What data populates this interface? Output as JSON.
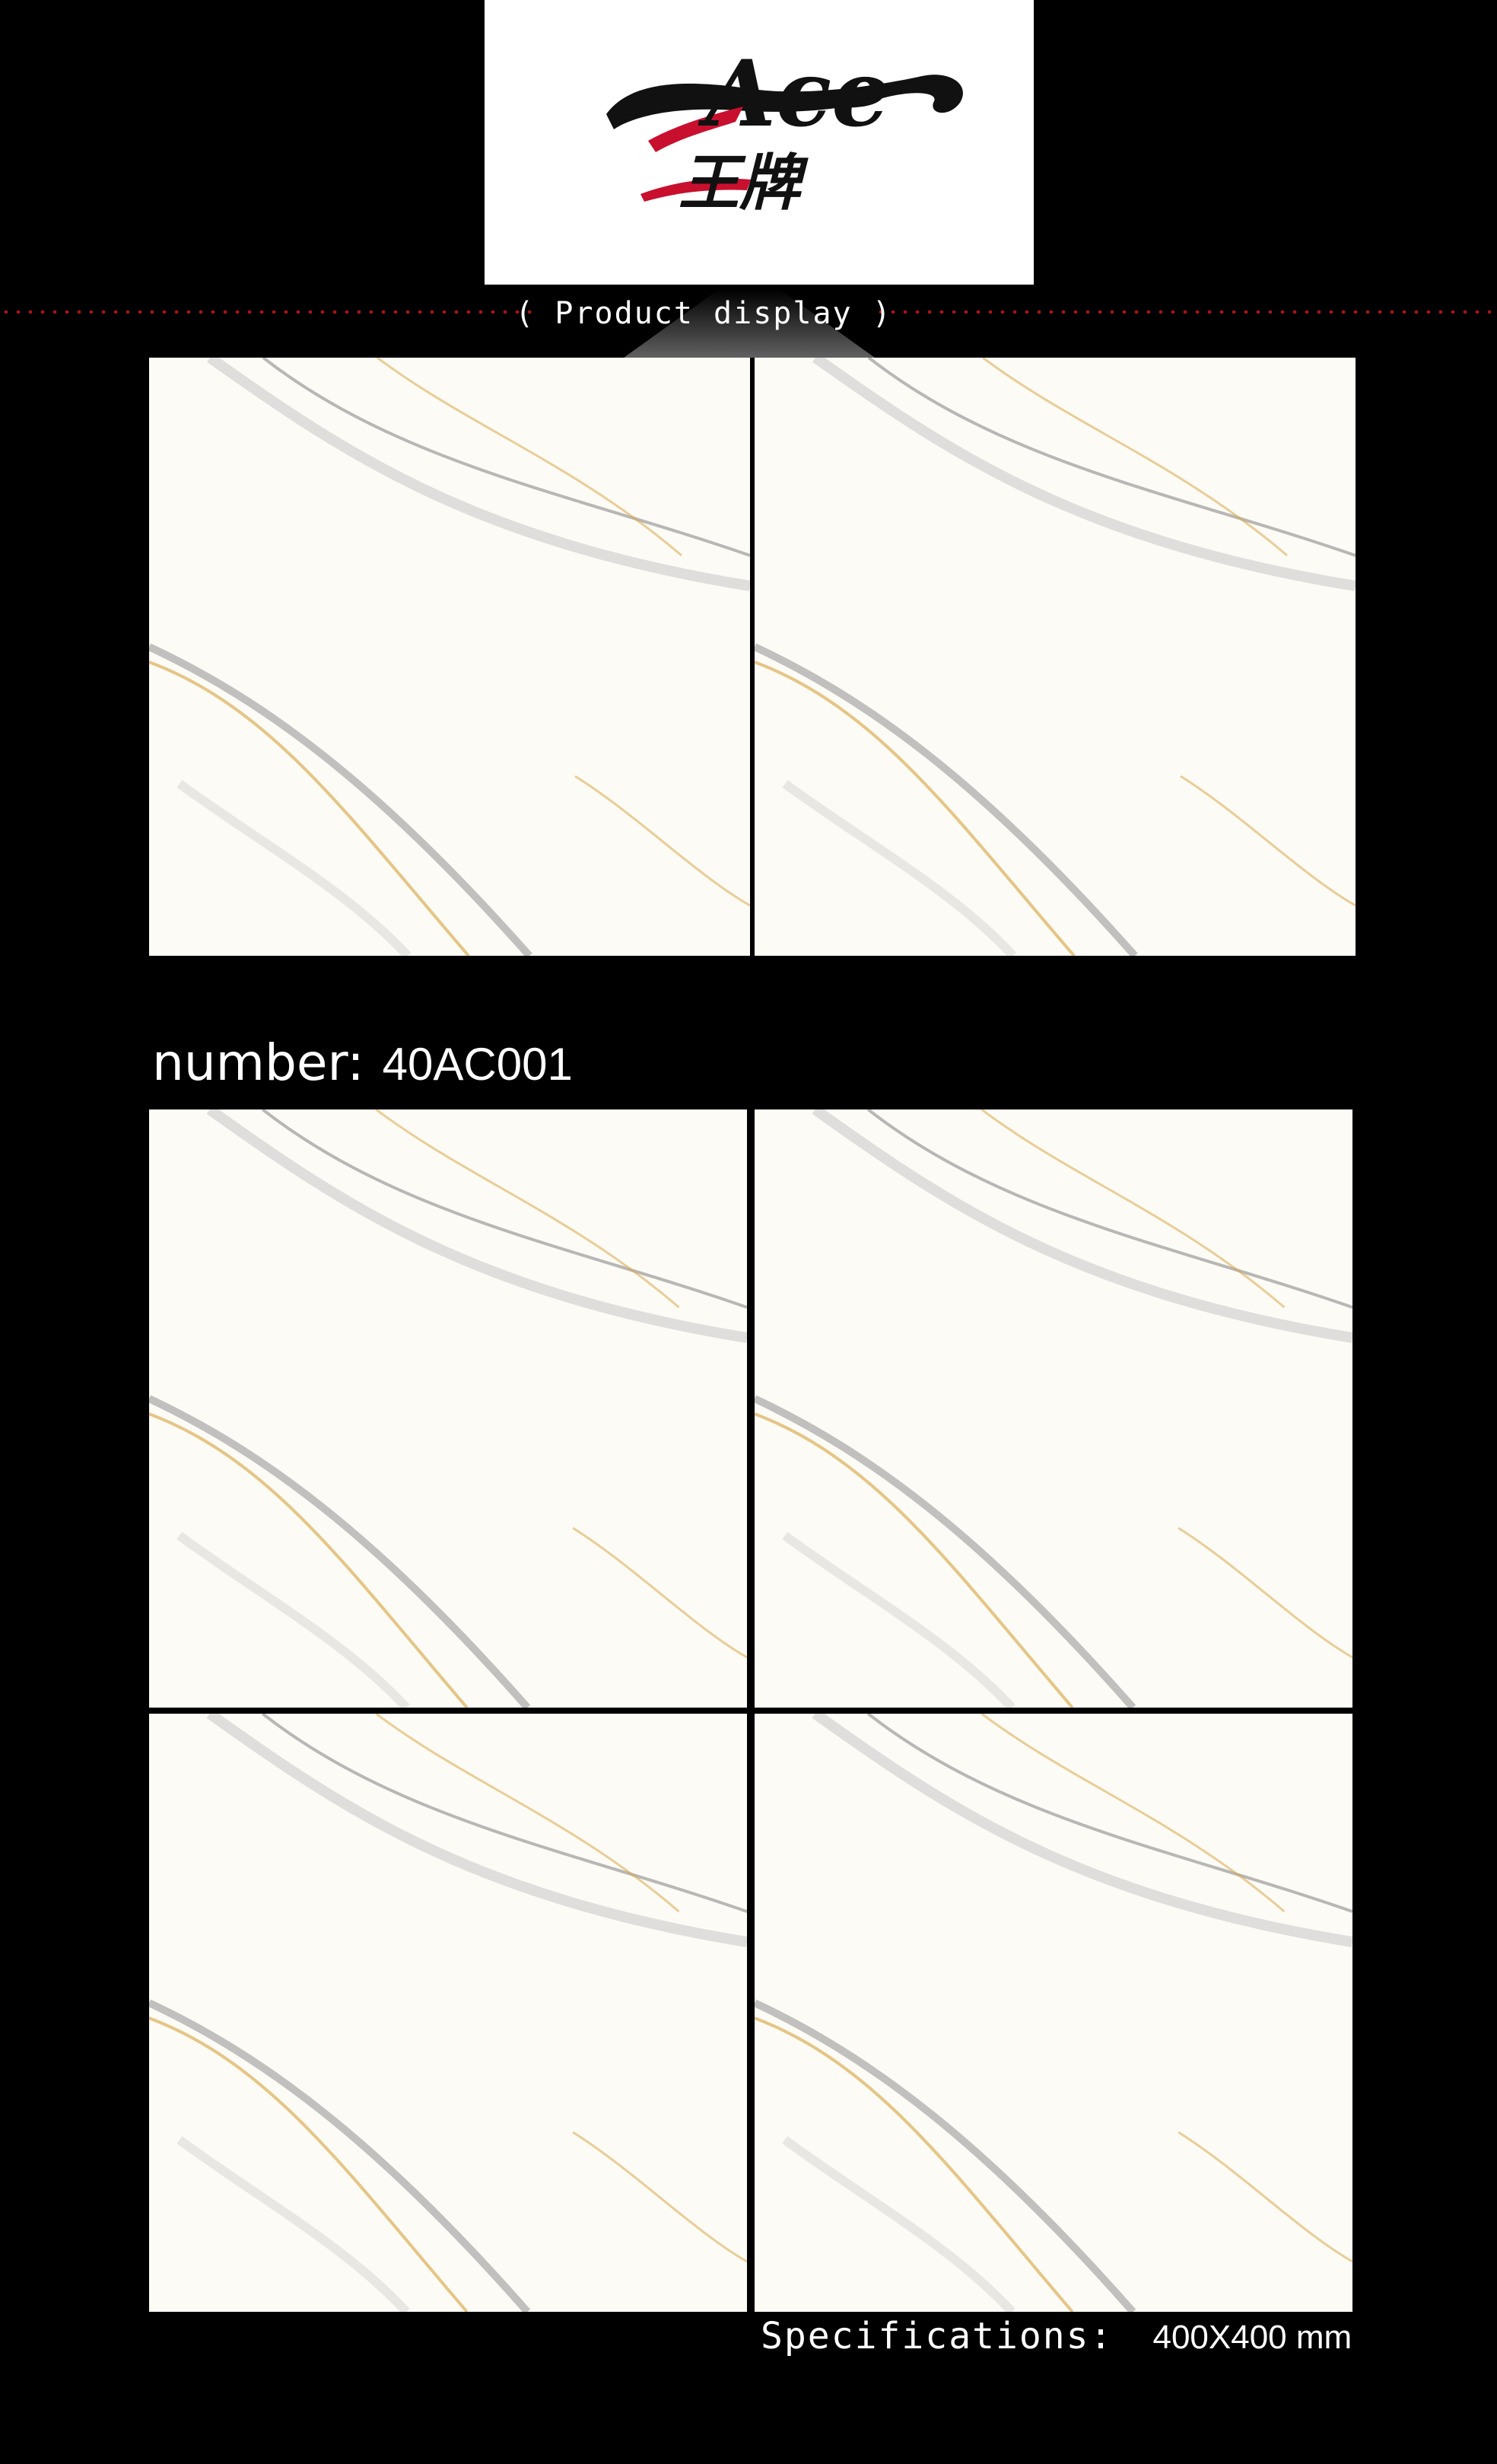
{
  "brand": {
    "logo_latin": "Ace",
    "logo_cjk": "王牌",
    "accent_color": "#c8102e",
    "ink_color": "#111111"
  },
  "section": {
    "label": "( Product display )"
  },
  "product": {
    "number_label": "number:",
    "number_value": "40AC001"
  },
  "specs": {
    "label": "Specifications:",
    "value": "400X400 mm"
  },
  "tiles": [
    {
      "name": "marble-tile-top-left"
    },
    {
      "name": "marble-tile-top-right"
    },
    {
      "name": "marble-tile-mid-left"
    },
    {
      "name": "marble-tile-mid-right"
    },
    {
      "name": "marble-tile-bottom-left"
    },
    {
      "name": "marble-tile-bottom-right"
    }
  ]
}
